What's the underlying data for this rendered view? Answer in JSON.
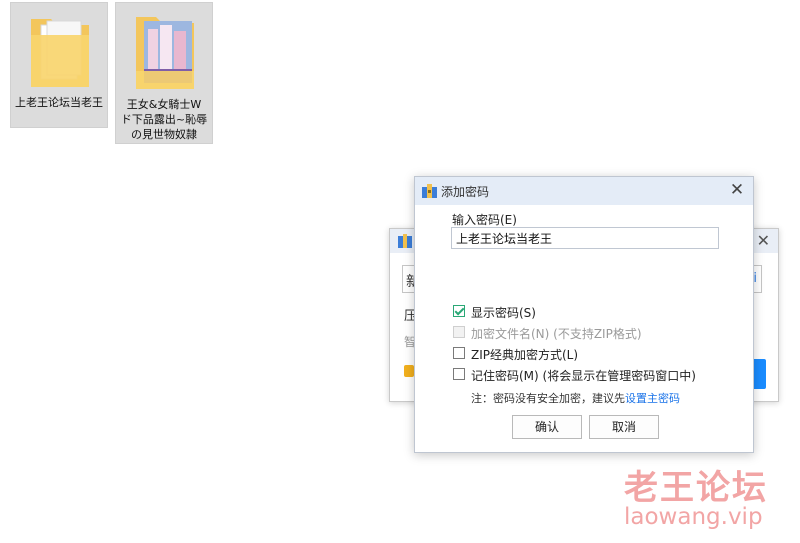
{
  "desktop": {
    "folders": [
      {
        "name": "上老王论坛当老王",
        "icon": "folder-icon"
      },
      {
        "name": "王女&女騎士W ド下品露出~恥辱の見世物奴隷",
        "icon": "folder-thumbnail-icon"
      }
    ]
  },
  "background_dialog": {
    "field_char": "新",
    "field_char_right": "i",
    "label_1": "压",
    "label_2": "智"
  },
  "dialog": {
    "title": "添加密码",
    "password_label": "输入密码(E)",
    "password_value": "上老王论坛当老王",
    "options": [
      {
        "label": "显示密码(S)",
        "checked": true,
        "enabled": true
      },
      {
        "label": "加密文件名(N) (不支持ZIP格式)",
        "checked": false,
        "enabled": false
      },
      {
        "label": "ZIP经典加密方式(L)",
        "checked": false,
        "enabled": true
      },
      {
        "label": "记住密码(M) (将会显示在管理密码窗口中)",
        "checked": false,
        "enabled": true
      }
    ],
    "note": "注：密码没有安全加密，建议先",
    "note_link": "设置主密码",
    "ok_label": "确认",
    "cancel_label": "取消"
  },
  "watermark": {
    "line1": "老王论坛",
    "line2": "laowang.vip"
  },
  "colors": {
    "accent": "#1a73e8",
    "check": "#2aa876",
    "watermark": "#f2a5a5"
  }
}
